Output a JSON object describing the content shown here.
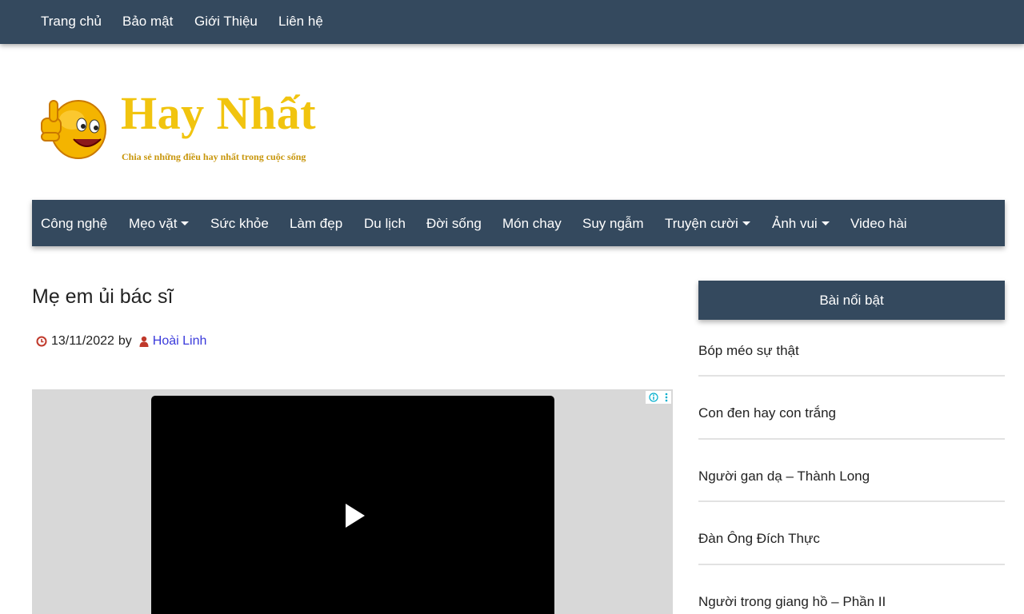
{
  "top_menu": {
    "items": [
      "Trang chủ",
      "Bảo mật",
      "Giới Thiệu",
      "Liên hệ"
    ]
  },
  "logo": {
    "title": "Hay Nhất",
    "tagline": "Chia sẻ những điều hay nhất trong cuộc sống",
    "icon": "thumbs-up-smiley-icon"
  },
  "main_menu": {
    "items": [
      {
        "label": "Công nghệ",
        "dropdown": false
      },
      {
        "label": "Mẹo vặt",
        "dropdown": true
      },
      {
        "label": "Sức khỏe",
        "dropdown": false
      },
      {
        "label": "Làm đẹp",
        "dropdown": false
      },
      {
        "label": "Du lịch",
        "dropdown": false
      },
      {
        "label": "Đời sống",
        "dropdown": false
      },
      {
        "label": "Món chay",
        "dropdown": false
      },
      {
        "label": "Suy ngẫm",
        "dropdown": false
      },
      {
        "label": "Truyện cười",
        "dropdown": true
      },
      {
        "label": "Ảnh vui",
        "dropdown": true
      },
      {
        "label": "Video hài",
        "dropdown": false
      }
    ]
  },
  "post": {
    "title": "Mẹ em ủi bác sĩ",
    "date": "13/11/2022",
    "by_label": "by",
    "author": "Hoài Linh"
  },
  "ad": {
    "icons": [
      "play-icon",
      "adchoices-info-icon",
      "more-options-icon"
    ]
  },
  "sidebar": {
    "heading": "Bài nổi bật",
    "items": [
      "Bóp méo sự thật",
      "Con đen hay con trắng",
      "Người gan dạ – Thành Long",
      "Đàn Ông Đích Thực",
      "Người trong giang hồ – Phần II"
    ]
  },
  "colors": {
    "nav_bg": "#34495e",
    "logo_yellow": "#f1c40f",
    "meta_icon_red": "#c0392b",
    "author_link": "#3a3adb"
  }
}
